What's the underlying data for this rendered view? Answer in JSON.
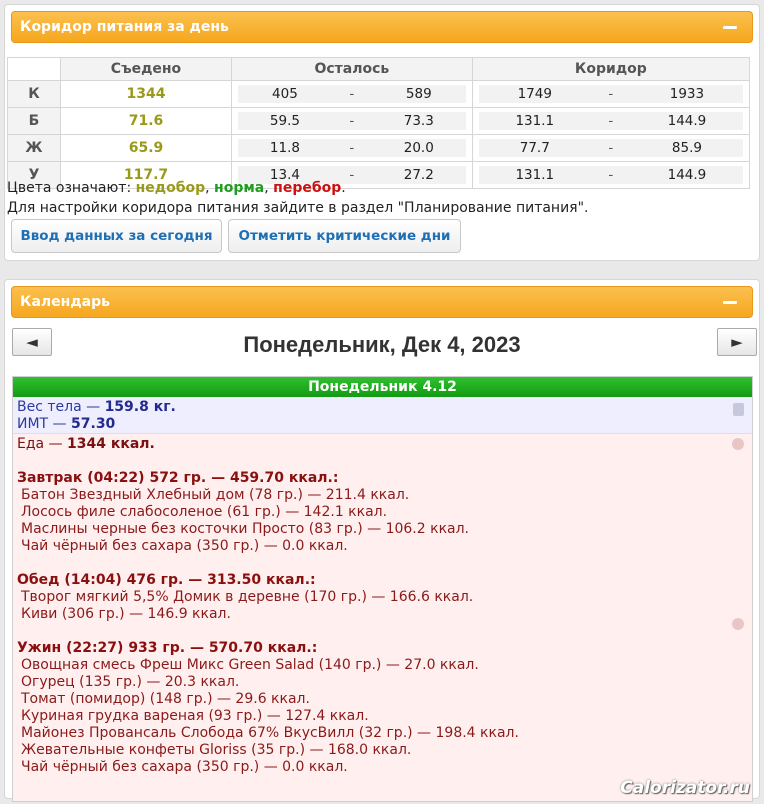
{
  "corridor": {
    "title": "Коридор питания за день",
    "headers": [
      "Съедено",
      "Осталось",
      "Коридор"
    ],
    "rows": [
      {
        "label": "К",
        "eaten": "1344",
        "left_from": "405",
        "left_to": "589",
        "cor_from": "1749",
        "cor_to": "1933"
      },
      {
        "label": "Б",
        "eaten": "71.6",
        "left_from": "59.5",
        "left_to": "73.3",
        "cor_from": "131.1",
        "cor_to": "144.9"
      },
      {
        "label": "Ж",
        "eaten": "65.9",
        "left_from": "11.8",
        "left_to": "20.0",
        "cor_from": "77.7",
        "cor_to": "85.9"
      },
      {
        "label": "У",
        "eaten": "117.7",
        "left_from": "13.4",
        "left_to": "27.2",
        "cor_from": "131.1",
        "cor_to": "144.9"
      }
    ],
    "dash": "-",
    "legend_prefix": "Цвета означают: ",
    "legend_low": "недобор",
    "legend_sep1": ", ",
    "legend_ok": "норма",
    "legend_sep2": ", ",
    "legend_high": "перебор",
    "legend_end": ".",
    "note": "Для настройки коридора питания зайдите в раздел \"Планирование питания\".",
    "btn_today": "Ввод данных за сегодня",
    "btn_critical": "Отметить критические дни",
    "colors": {
      "low": "#9a9a1a",
      "ok": "#1e9e1e",
      "high": "#cc1111",
      "accent": "#f5a71e"
    }
  },
  "calendar": {
    "title": "Календарь",
    "prev": "◄",
    "next": "►",
    "date": "Понедельник, Дек 4, 2023",
    "day_label": "Понедельник 4.12",
    "weight_label": "Вес тела — ",
    "weight_value": "159.8 кг.",
    "bmi_label": "ИМТ — ",
    "bmi_value": "57.30",
    "food_label": "Еда — ",
    "food_value": "1344 ккал.",
    "meals": [
      {
        "title": "Завтрак (04:22) 572 гр. — 459.70 ккал.:",
        "items": [
          "Батон Звездный Хлебный дом (78 гр.) — 211.4 ккал.",
          "Лосось филе слабосоленое (61 гр.) — 142.1 ккал.",
          "Маслины черные без косточки Просто (83 гр.) — 106.2 ккал.",
          "Чай чёрный без сахара (350 гр.) — 0.0 ккал."
        ]
      },
      {
        "title": "Обед (14:04) 476 гр. — 313.50 ккал.:",
        "items": [
          "Творог мягкий 5,5% Домик в деревне (170 гр.) — 166.6 ккал.",
          "Киви (306 гр.) — 146.9 ккал."
        ]
      },
      {
        "title": "Ужин (22:27) 933 гр. — 570.70 ккал.:",
        "items": [
          "Овощная смесь Фреш Микс Green Salad (140 гр.) — 27.0 ккал.",
          "Огурец (135 гр.) — 20.3 ккал.",
          "Томат (помидор) (148 гр.) — 29.6 ккал.",
          "Куриная грудка вареная (93 гр.) — 127.4 ккал.",
          "Майонез Провансаль Слобода 67% ВкусВилл (32 гр.) — 198.4 ккал.",
          "Жевательные конфеты Gloriss (35 гр.) — 168.0 ккал.",
          "Чай чёрный без сахара (350 гр.) — 0.0 ккал."
        ]
      }
    ],
    "icons": [
      "scale-icon",
      "food-icon"
    ]
  },
  "watermark": "Calorizator.ru"
}
